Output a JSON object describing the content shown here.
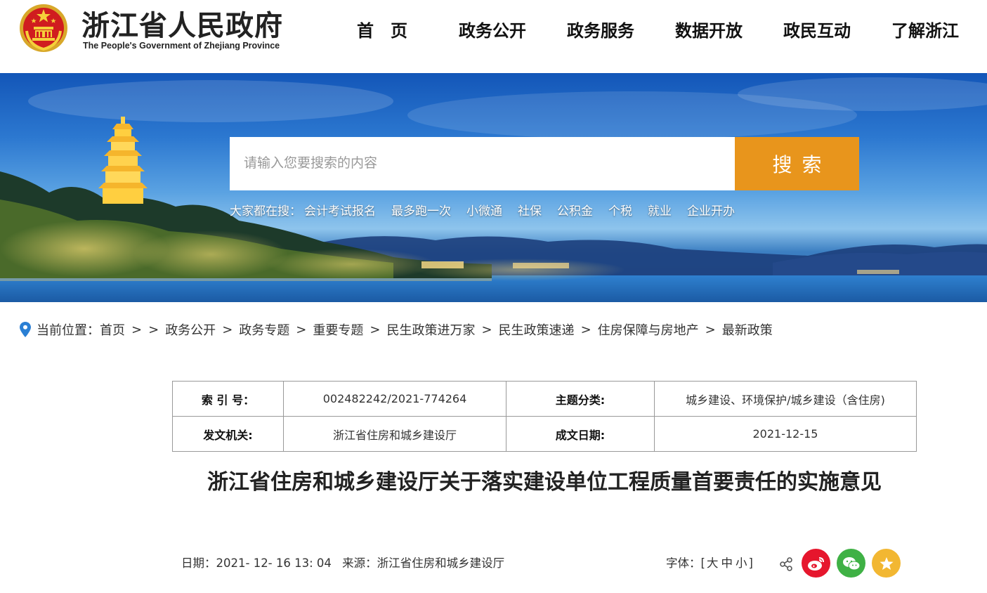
{
  "header": {
    "site_title": "浙江省人民政府",
    "site_subtitle": "The People's Government of Zhejiang Province"
  },
  "nav": {
    "items": [
      {
        "label": "首　页"
      },
      {
        "label": "政务公开"
      },
      {
        "label": "政务服务"
      },
      {
        "label": "数据开放"
      },
      {
        "label": "政民互动"
      },
      {
        "label": "了解浙江"
      }
    ]
  },
  "search": {
    "placeholder": "请输入您要搜索的内容",
    "button_label": "搜索",
    "hot_label": "大家都在搜：",
    "hot_words": [
      "会计考试报名",
      "最多跑一次",
      "小微通",
      "社保",
      "公积金",
      "个税",
      "就业",
      "企业开办"
    ]
  },
  "breadcrumb": {
    "label": "当前位置：",
    "items": [
      "首页",
      "",
      "政务公开",
      "政务专题",
      "重要专题",
      "民生政策进万家",
      "民生政策速递",
      "住房保障与房地产",
      "最新政策"
    ]
  },
  "meta": {
    "index_key": "索 引 号：",
    "index_value": "002482242/2021-774264",
    "topic_key": "主题分类:",
    "topic_value": "城乡建设、环境保护/城乡建设（含住房)",
    "issuer_key": "发文机关:",
    "issuer_value": "浙江省住房和城乡建设厅",
    "date_key": "成文日期:",
    "date_value": "2021-12-15"
  },
  "article": {
    "title": "浙江省住房和城乡建设厅关于落实建设单位工程质量首要责任的实施意见",
    "date_label": "日期：",
    "date_value": "2021- 12- 16 13: 04",
    "source_label": "来源：",
    "source_value": "浙江省住房和城乡建设厅",
    "font_label": "字体：[",
    "font_large": "大",
    "font_medium": "中",
    "font_small": "小",
    "font_end": "]"
  },
  "colors": {
    "search_button": "#e8951c",
    "weibo": "#e6162d",
    "wechat": "#3fb145",
    "favorite": "#f2b732"
  },
  "icons": [
    "national-emblem-icon",
    "location-pin-icon",
    "share-icon",
    "weibo-icon",
    "wechat-icon",
    "favorite-star-icon"
  ]
}
